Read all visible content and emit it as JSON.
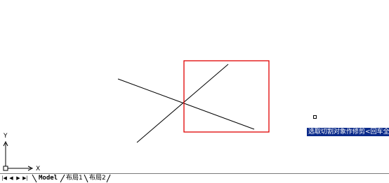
{
  "ucs": {
    "x_label": "X",
    "y_label": "Y"
  },
  "command_tooltip": {
    "text": "选取切割对象作修剪<回车全选>"
  },
  "layout_tabs": [
    {
      "label": "Model",
      "active": true
    },
    {
      "label": "布局1",
      "active": false
    },
    {
      "label": "布局2",
      "active": false
    }
  ],
  "nav_buttons": [
    "first-tab",
    "previous-tab",
    "next-tab",
    "last-tab"
  ],
  "colors": {
    "background": "#ffffff",
    "selection_box": "#e00000",
    "lines": "#000000",
    "tooltip_bg": "#0a2a8a"
  }
}
